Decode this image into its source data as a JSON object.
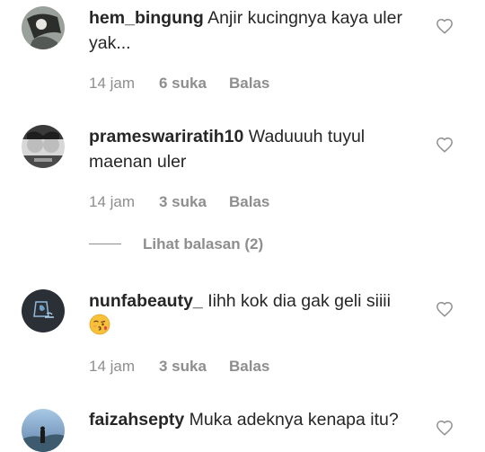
{
  "comments": [
    {
      "username": "hem_bingung",
      "text": "Anjir kucingnya kaya uler yak...",
      "time": "14 jam",
      "likes": "6 suka",
      "reply": "Balas",
      "avatar_color": "#6c6f6b"
    },
    {
      "username": "prameswariratih10",
      "text": "Waduuuh tuyul maenan uler",
      "time": "14 jam",
      "likes": "3 suka",
      "reply": "Balas",
      "avatar_color": "#7a7a7a"
    },
    {
      "username": "nunfabeauty_",
      "text": "Iihh kok dia gak geli siiii",
      "time": "14 jam",
      "likes": "3 suka",
      "reply": "Balas",
      "avatar_color": "#2b2f36",
      "emoji": "kissing-face-icon"
    },
    {
      "username": "faizahsepty",
      "text": "Muka adeknya kenapa itu?",
      "avatar_color": "#6d8fb5"
    }
  ],
  "view_replies": "Lihat balasan (2)",
  "colors": {
    "primary_text": "#262626",
    "secondary_text": "#8e8e8e",
    "background": "#ffffff"
  }
}
